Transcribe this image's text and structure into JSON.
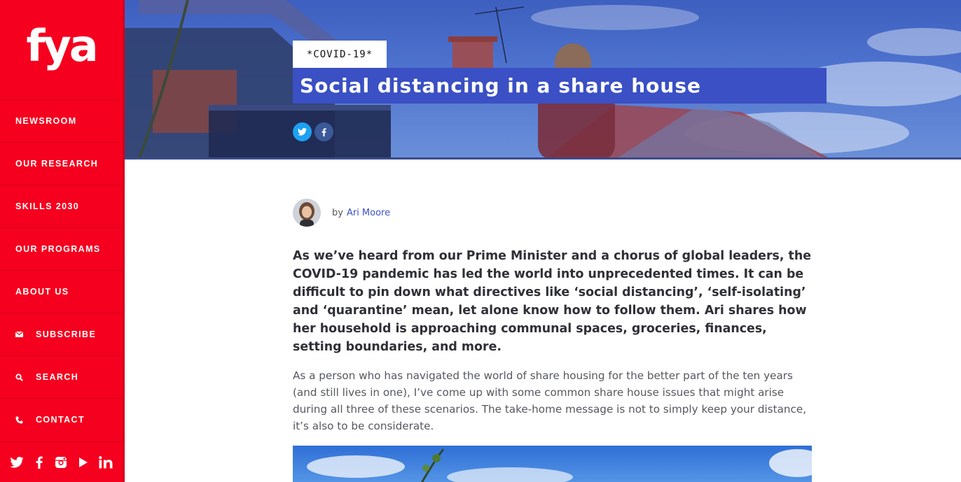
{
  "brand": {
    "logo_text": "fya",
    "accent": "#f5001f",
    "title_band_color": "#3a50c4"
  },
  "nav": {
    "items": [
      {
        "label": "NEWSROOM",
        "icon": ""
      },
      {
        "label": "OUR RESEARCH",
        "icon": ""
      },
      {
        "label": "SKILLS 2030",
        "icon": ""
      },
      {
        "label": "OUR PROGRAMS",
        "icon": ""
      },
      {
        "label": "ABOUT US",
        "icon": ""
      },
      {
        "label": "SUBSCRIBE",
        "icon": "mail-icon"
      },
      {
        "label": "SEARCH",
        "icon": "search-icon"
      },
      {
        "label": "CONTACT",
        "icon": "phone-icon"
      }
    ],
    "social": [
      "twitter-icon",
      "facebook-icon",
      "instagram-icon",
      "youtube-icon",
      "linkedin-icon"
    ]
  },
  "hero": {
    "tag": "*COVID-19*",
    "title": "Social distancing in a share house",
    "share": [
      "twitter-icon",
      "facebook-icon"
    ]
  },
  "article": {
    "by": "by",
    "author": "Ari Moore",
    "lead": "As we’ve heard from our Prime Minister and a chorus of global leaders, the COVID-19 pandemic has led the world into unprecedented times. It can be difficult to pin down what directives like ‘social distancing’, ‘self-isolating’ and ‘quarantine’ mean, let alone know how to follow them. Ari shares how her household is approaching communal spaces, groceries, finances, setting boundaries, and more.",
    "body": "As a person who has navigated the world of share housing for the better part of the ten years (and still lives in one), I’ve come up with some common share house issues that might arise during all three of these scenarios. The take-home message is not to simply keep your distance, it’s also to be considerate."
  }
}
